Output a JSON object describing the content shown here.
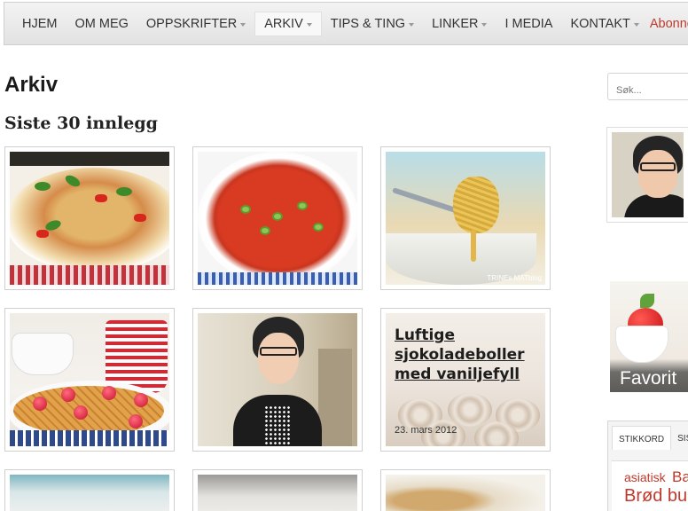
{
  "nav": {
    "items": [
      {
        "label": "HJEM",
        "dropdown": false,
        "active": false
      },
      {
        "label": "OM MEG",
        "dropdown": false,
        "active": false
      },
      {
        "label": "OPPSKRIFTER",
        "dropdown": true,
        "active": false
      },
      {
        "label": "ARKIV",
        "dropdown": true,
        "active": true
      },
      {
        "label": "TIPS & TING",
        "dropdown": true,
        "active": false
      },
      {
        "label": "LINKER",
        "dropdown": true,
        "active": false
      },
      {
        "label": "I MEDIA",
        "dropdown": false,
        "active": false
      },
      {
        "label": "KONTAKT",
        "dropdown": true,
        "active": false
      }
    ],
    "subscribe_label": "Abonner p",
    "subscribe_color": "#c0392b"
  },
  "main": {
    "title": "Arkiv",
    "subtitle": "Siste 30 innlegg",
    "posts": [
      {
        "kind": "image",
        "subject": "pasta salad"
      },
      {
        "kind": "image",
        "subject": "tomato soup"
      },
      {
        "kind": "image",
        "subject": "noodles on fork",
        "watermark": "TRINEs MATblog"
      },
      {
        "kind": "image",
        "subject": "waffles with strawberries"
      },
      {
        "kind": "image",
        "subject": "woman in kitchen"
      },
      {
        "kind": "text",
        "title": "Luftige sjokoladeboller med vaniljefyll",
        "date": "23. mars 2012"
      }
    ]
  },
  "sidebar": {
    "search_placeholder": "Søk...",
    "favorites_caption": "Favorit",
    "tabs": [
      "STIKKORD",
      "SIST"
    ],
    "tags": [
      "asiatisk",
      "Ba",
      "Brød bu"
    ]
  }
}
